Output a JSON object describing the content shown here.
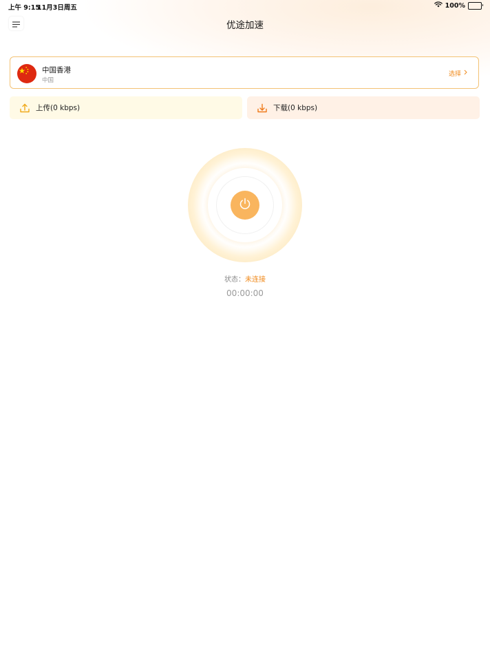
{
  "status_bar": {
    "time": "上午 9:15",
    "date": "11月3日周五",
    "battery": "100%",
    "wifi_icon": "wifi-icon",
    "battery_icon": "battery-icon"
  },
  "header": {
    "title": "优途加速",
    "menu_icon": "menu-icon"
  },
  "server": {
    "name": "中国香港",
    "region": "中国",
    "flag_icon": "china-flag-icon",
    "select_label": "选择",
    "select_icon": "chevron-right-icon"
  },
  "speed": {
    "upload_label": "上传(0 kbps)",
    "download_label": "下载(0 kbps)",
    "upload_icon": "upload-icon",
    "download_icon": "download-icon"
  },
  "connection": {
    "power_icon": "power-icon",
    "status_label": "状态：",
    "status_value": "未连接",
    "timer": "00:00:00"
  },
  "colors": {
    "accent": "#f08a1c",
    "power_button": "#f9b55e",
    "card_border": "#f3c274",
    "upload_bg": "#fffae6",
    "download_bg": "#fff1e6"
  }
}
